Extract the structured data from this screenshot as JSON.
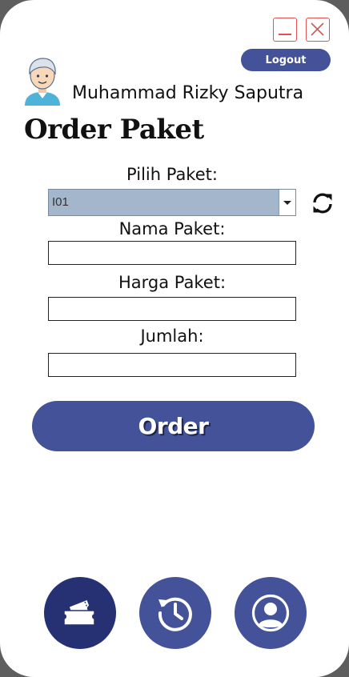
{
  "window": {
    "minimize_icon": "minimize-icon",
    "close_icon": "close-icon"
  },
  "header": {
    "logout_label": "Logout",
    "username": "Muhammad Rizky Saputra",
    "avatar_icon": "user-avatar-icon"
  },
  "page": {
    "title": "Order Paket"
  },
  "form": {
    "pilih_label": "Pilih Paket:",
    "pilih_value": "I01",
    "nama_label": "Nama Paket:",
    "nama_value": "",
    "harga_label": "Harga Paket:",
    "harga_value": "",
    "jumlah_label": "Jumlah:",
    "jumlah_value": "",
    "refresh_icon": "refresh-icon"
  },
  "actions": {
    "order_label": "Order"
  },
  "nav": {
    "items": [
      {
        "icon": "ticket-icon",
        "active": true
      },
      {
        "icon": "history-icon",
        "active": false
      },
      {
        "icon": "profile-icon",
        "active": false
      }
    ]
  },
  "colors": {
    "accent": "#44529a",
    "accent_dark": "#263174",
    "window_control": "#e05252",
    "combo_bg": "#a3b6cc"
  }
}
